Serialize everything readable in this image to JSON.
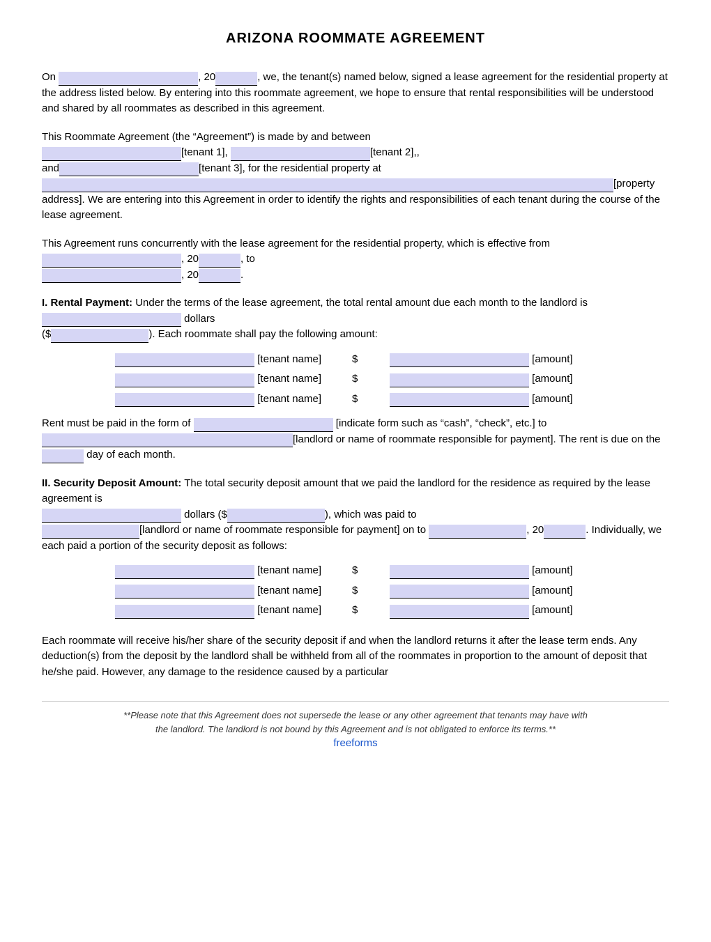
{
  "title": "ARIZONA ROOMMATE AGREEMENT",
  "para1": {
    "prefix": "On",
    "year_prefix": ", 20",
    "year_suffix": ", we, the tenant(s) named below, signed a lease agreement for the residential property at the address listed below. By entering into this roommate agreement, we hope to ensure that rental responsibilities will be understood and shared by all roommates as described in this agreement."
  },
  "para2": {
    "text1": "This Roommate Agreement (the “Agreement”) is made by and between",
    "label1": "[tenant 1],",
    "label2": "[tenant 2],,",
    "label3": "and",
    "label4": "[tenant 3], for the residential property at",
    "label5": "[property address]. We are entering into this Agreement in order to identify the rights and responsibilities of each tenant during the course of the lease agreement."
  },
  "para3": {
    "text1": "This Agreement runs concurrently with the lease agreement for the residential property, which is effective from",
    "year1_prefix": ", 20",
    "year1_value": "____,",
    "to": "to",
    "year2_prefix": ", 20",
    "year2_value": "____."
  },
  "section1": {
    "heading": "I.  Rental Payment:",
    "text1": "Under the terms of the lease agreement, the total rental amount due each month to the landlord is",
    "text2": "dollars",
    "text3": "($",
    "text4": ").  Each roommate shall pay the following amount:",
    "tenants": [
      {
        "name_label": "[tenant name]",
        "dollar": "$",
        "amount_label": "[amount]"
      },
      {
        "name_label": "[tenant name]",
        "dollar": "$",
        "amount_label": "[amount]"
      },
      {
        "name_label": "[tenant name]",
        "dollar": "$",
        "amount_label": "[amount]"
      }
    ],
    "text5": "Rent must be paid in the form of",
    "text6": "[indicate form such as “cash”, “check”, etc.] to",
    "text7": "[landlord or name of roommate responsible for payment]. The rent is due on the",
    "text8": "day of each month."
  },
  "section2": {
    "heading": "II.  Security Deposit Amount:",
    "text1": "The total security deposit amount that we paid the landlord for the residence as required by the lease agreement is",
    "text2": "dollars ($",
    "text3": "), which was paid to",
    "text4": "[landlord or name of roommate responsible for payment] on to",
    "text5": ", 20",
    "text6": ".  Individually, we each paid a portion of the security deposit as follows:",
    "tenants": [
      {
        "name_label": "[tenant name]",
        "dollar": "$",
        "amount_label": "[amount]"
      },
      {
        "name_label": "[tenant name]",
        "dollar": "$",
        "amount_label": "[amount]"
      },
      {
        "name_label": "[tenant name]",
        "dollar": "$",
        "amount_label": "[amount]"
      }
    ]
  },
  "para_last": "Each roommate will receive his/her share of the security deposit if and when the landlord returns it after the lease term ends. Any deduction(s) from the deposit by the landlord shall be withheld from all of the roommates in proportion to the amount of deposit that he/she paid. However, any damage to the residence caused by a particular",
  "footer": {
    "line1": "**Please note that this Agreement does not supersede the lease or any other agreement that tenants may have with",
    "line2": "the landlord. The landlord is not bound by this Agreement and is not obligated to enforce its terms.**",
    "brand": "freeforms"
  }
}
